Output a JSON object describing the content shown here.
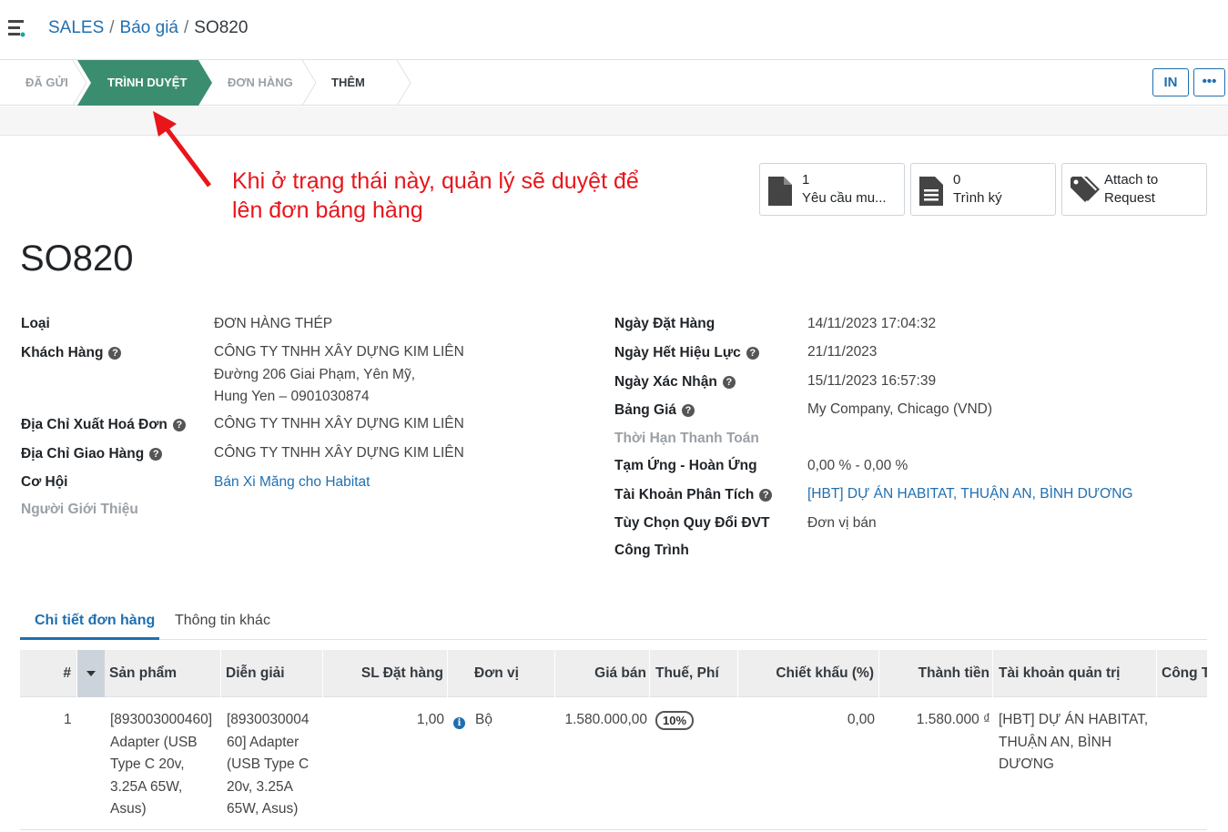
{
  "breadcrumb": {
    "app": "SALES",
    "section": "Báo giá",
    "record": "SO820"
  },
  "status_stages": [
    "ĐÃ GỬI",
    "TRÌNH DUYỆT",
    "ĐƠN HÀNG",
    "THÊM"
  ],
  "active_stage": "TRÌNH DUYỆT",
  "header_buttons": {
    "print": "IN",
    "more": "•••"
  },
  "annotation": {
    "line1": "Khi ở trạng thái này, quản lý sẽ duyệt để",
    "line2": "lên đơn báng hàng",
    "color": "#e8151b"
  },
  "smart_buttons": [
    {
      "count": "1",
      "label": "Yêu cầu mu...",
      "icon": "document-icon"
    },
    {
      "count": "0",
      "label": "Trình ký",
      "icon": "document-lines-icon"
    },
    {
      "count": "Attach to",
      "label": "Request",
      "icon": "tags-icon"
    }
  ],
  "record_title": "SO820",
  "left_fields": {
    "type_label": "Loại",
    "type_value": "ĐƠN HÀNG THÉP",
    "customer_label": "Khách Hàng",
    "customer_line1": "CÔNG TY TNHH XÂY DỰNG KIM LIÊN",
    "customer_line2": "Đường 206 Giai Phạm, Yên Mỹ,",
    "customer_line3": "Hung Yen – 0901030874",
    "invoice_addr_label": "Địa Chỉ Xuất Hoá Đơn",
    "invoice_addr_value": "CÔNG TY TNHH XÂY DỰNG KIM LIÊN",
    "delivery_addr_label": "Địa Chỉ Giao Hàng",
    "delivery_addr_value": "CÔNG TY TNHH XÂY DỰNG KIM LIÊN",
    "opportunity_label": "Cơ Hội",
    "opportunity_value": "Bán Xi Măng cho Habitat",
    "referrer_label": "Người Giới Thiệu"
  },
  "right_fields": {
    "order_date_label": "Ngày Đặt Hàng",
    "order_date_value": "14/11/2023 17:04:32",
    "expiry_label": "Ngày Hết Hiệu Lực",
    "expiry_value": "21/11/2023",
    "confirm_label": "Ngày Xác Nhận",
    "confirm_value": "15/11/2023 16:57:39",
    "pricelist_label": "Bảng Giá",
    "pricelist_value": "My Company, Chicago (VND)",
    "payment_terms_label": "Thời Hạn Thanh Toán",
    "advance_label": "Tạm Ứng - Hoàn Ứng",
    "advance_value": "0,00 % - 0,00 %",
    "analytic_label": "Tài Khoản Phân Tích",
    "analytic_value": "[HBT] DỰ ÁN HABITAT, THUẬN AN, BÌNH DƯƠNG",
    "uom_option_label": "Tùy Chọn Quy Đổi ĐVT",
    "uom_option_value": "Đơn vị bán",
    "project_label": "Công Trình"
  },
  "tabs": [
    "Chi tiết đơn hàng",
    "Thông tin khác"
  ],
  "table": {
    "headers": [
      "#",
      "Sản phẩm",
      "Diễn giải",
      "SL Đặt hàng",
      "Đơn vị",
      "Giá bán",
      "Thuế, Phí",
      "Chiết khấu (%)",
      "Thành tiền",
      "Tài khoản quản trị",
      "Công T"
    ],
    "row": {
      "num": "1",
      "product": [
        "[893003000460]",
        "Adapter (USB",
        "Type C 20v,",
        "3.25A 65W,",
        "Asus)"
      ],
      "description": [
        "[8930030004",
        "60] Adapter",
        "(USB Type C",
        "20v, 3.25A",
        "65W, Asus)"
      ],
      "qty": "1,00",
      "uom": "Bộ",
      "price": "1.580.000,00",
      "tax": "10%",
      "discount": "0,00",
      "subtotal": "1.580.000 ₫",
      "analytic": [
        "[HBT] DỰ ÁN HABITAT,",
        "THUẬN AN, BÌNH",
        "DƯƠNG"
      ]
    }
  },
  "colors": {
    "accent": "#1f6fb0",
    "stage_active": "#3b8d70",
    "annotation": "#e8151b"
  }
}
